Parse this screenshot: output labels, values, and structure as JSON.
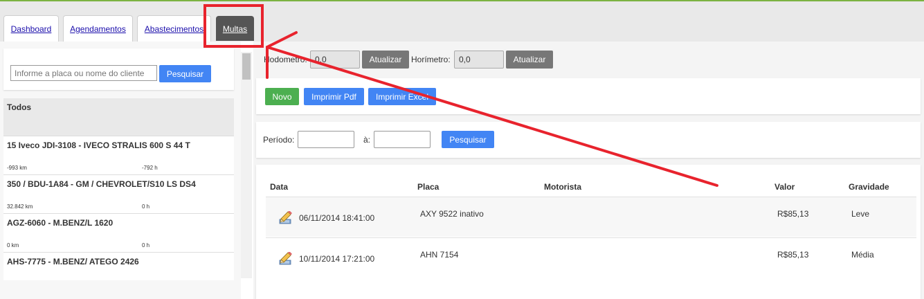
{
  "tabs": [
    {
      "label": "Dashboard",
      "active": false
    },
    {
      "label": "Agendamentos",
      "active": false
    },
    {
      "label": "Abastecimentos",
      "active": false
    },
    {
      "label": "Multas",
      "active": true
    }
  ],
  "sidebar": {
    "search_placeholder": "Informe a placa ou nome do cliente",
    "search_button": "Pesquisar",
    "all_label": "Todos",
    "vehicles": [
      {
        "name": "15 Iveco JDI-3108 - IVECO STRALIS 600 S 44 T",
        "km": "-993 km",
        "hours": "-792 h"
      },
      {
        "name": "350 / BDU-1A84 - GM / CHEVROLET/S10 LS DS4",
        "km": "32.842 km",
        "hours": "0 h"
      },
      {
        "name": "AGZ-6060 - M.BENZ/L 1620",
        "km": "0 km",
        "hours": "0 h"
      },
      {
        "name": "AHS-7775 - M.BENZ/ ATEGO 2426",
        "km": "",
        "hours": ""
      }
    ]
  },
  "meters": {
    "odometer_label": "Hodometro:",
    "odometer_value": "0,0",
    "hourmeter_label": "Horímetro:",
    "hourmeter_value": "0,0",
    "update_label": "Atualizar"
  },
  "actions": {
    "new_label": "Novo",
    "print_pdf_label": "Imprimir Pdf",
    "print_excel_label": "Imprimir Excel"
  },
  "filter": {
    "period_label": "Período:",
    "to_label": "à:",
    "search_label": "Pesquisar"
  },
  "table": {
    "columns": [
      "Data",
      "Placa",
      "Motorista",
      "Valor",
      "Gravidade"
    ],
    "rows": [
      {
        "date": "06/11/2014 18:41:00",
        "plate": "AXY 9522 inativo",
        "driver": "",
        "value": "R$85,13",
        "severity": "Leve"
      },
      {
        "date": "10/11/2014 17:21:00",
        "plate": "AHN 7154",
        "driver": "",
        "value": "R$85,13",
        "severity": "Média"
      }
    ]
  },
  "colors": {
    "annotation": "#e8232d",
    "primary_button": "#4285f4",
    "success_button": "#4caf50",
    "neutral_button": "#777777",
    "active_tab": "#555555"
  }
}
